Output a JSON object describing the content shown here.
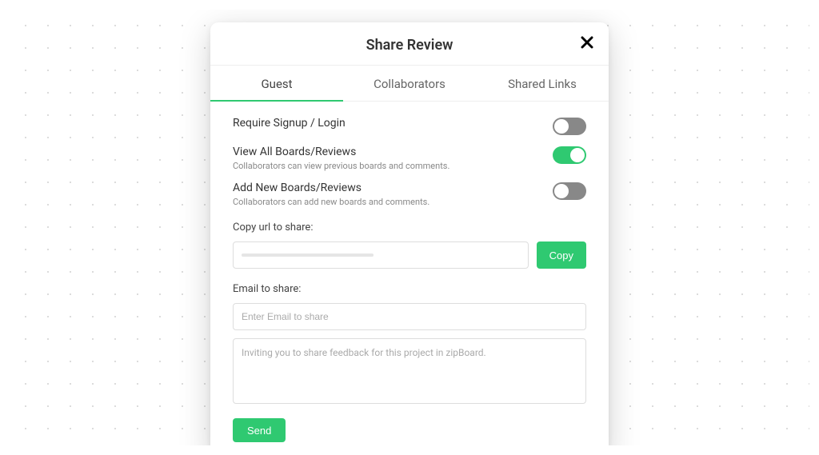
{
  "modal": {
    "title": "Share Review",
    "tabs": [
      {
        "label": "Guest",
        "active": true
      },
      {
        "label": "Collaborators",
        "active": false
      },
      {
        "label": "Shared Links",
        "active": false
      }
    ],
    "settings": {
      "requireSignup": {
        "title": "Require Signup / Login",
        "desc": "",
        "on": false
      },
      "viewAll": {
        "title": "View All Boards/Reviews",
        "desc": "Collaborators can view previous boards and comments.",
        "on": true
      },
      "addNew": {
        "title": "Add New Boards/Reviews",
        "desc": "Collaborators can add new boards and comments.",
        "on": false
      }
    },
    "copyUrl": {
      "label": "Copy url to share:",
      "buttonLabel": "Copy"
    },
    "email": {
      "label": "Email to share:",
      "inputPlaceholder": "Enter Email to share",
      "messagePlaceholder": "Inviting you to share feedback for this project in zipBoard.",
      "sendLabel": "Send"
    }
  },
  "colors": {
    "accent": "#2fc971",
    "toggleOff": "#888888"
  }
}
